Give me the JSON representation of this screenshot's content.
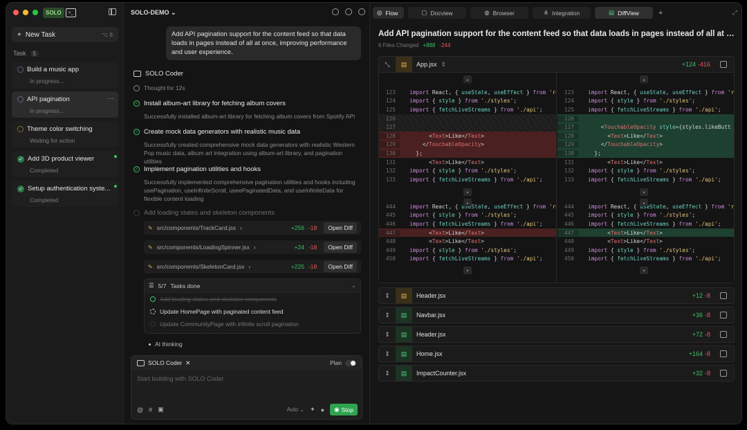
{
  "sidebar": {
    "logo": "SOLO",
    "new_task": {
      "label": "New Task",
      "shortcut": "⌥ 8"
    },
    "task_header": "Task",
    "task_count": "5",
    "tasks": [
      {
        "title": "Build a music app",
        "status": "In progress..."
      },
      {
        "title": "API pagination",
        "status": "In progress..."
      },
      {
        "title": "Theme color switching",
        "status": "Waiting for action"
      },
      {
        "title": "Add 3D product viewer",
        "status": "Completed"
      },
      {
        "title": "Setup authentication syste...",
        "status": "Completed"
      }
    ]
  },
  "chat": {
    "project": "SOLO-DEMO",
    "user_message": "Add API pagination support for the content feed so that data loads in pages instead of all at once, improving performance and user experience.",
    "agent_name": "SOLO Coder",
    "thought": "Thought for 12s",
    "steps": [
      {
        "title": "Install album-art library for fetching album covers",
        "desc": "Successfully installed album-art library for fetching album covers from Spotify API"
      },
      {
        "title": "Create mock data generators with realistic music data",
        "desc": "Successfully created comprehensive mock data generators with realistic Western Pop music data, album art integration using album-art library, and pagination utilities"
      },
      {
        "title": "Implement pagination utilities and hooks",
        "desc": "Successfully implemented comprehensive pagination utilities and hooks including usePagination, useInfiniteScroll, useePaginatedData, and useInfiniteData for flexible content loading"
      }
    ],
    "loading_step": "Add loading states and skeleton components",
    "files": [
      {
        "path": "src/components/TrackCard.jsx",
        "add": "+256",
        "del": "-18",
        "button": "Open Diff"
      },
      {
        "path": "src/components/LoadingSpinner.jsx",
        "add": "+24",
        "del": "-18",
        "button": "Open Diff"
      },
      {
        "path": "src/components/SkeletonCard.jsx",
        "add": "+225",
        "del": "-18",
        "button": "Open Diff"
      }
    ],
    "todo": {
      "progress": "5/7",
      "label": "Tasks done",
      "items": [
        {
          "text": "Add loading states and skeleton components",
          "state": "done"
        },
        {
          "text": "Update HomePage with paginated content feed",
          "state": "active"
        },
        {
          "text": "Update CommunityPage with infinite scroll pagination",
          "state": "pending"
        }
      ]
    },
    "ai_thinking": "AI thinking",
    "composer": {
      "agent": "SOLO Coder",
      "plan_label": "Plan",
      "placeholder": "Start building with SOLO Coder",
      "mode": "Auto",
      "stop": "Stop"
    }
  },
  "right": {
    "tabs": [
      "Flow",
      "Docview",
      "Browser",
      "Integration",
      "DiffView"
    ],
    "active_tab": "DiffView",
    "title": "Add API pagination support for the content feed so that data loads in pages instead of all at once, improving performance and user experience.",
    "files_changed": "6 Files Changed",
    "total_add": "+888",
    "total_del": "-244",
    "main_file": {
      "name": "App.jsx",
      "add": "+124",
      "del": "-416"
    },
    "other_files": [
      {
        "name": "Header.jsx",
        "add": "+12",
        "del": "-8",
        "color": "yellow"
      },
      {
        "name": "Navbar.jsx",
        "add": "+36",
        "del": "-8",
        "color": "green"
      },
      {
        "name": "Header.jsx",
        "add": "+72",
        "del": "-8",
        "color": "green"
      },
      {
        "name": "Home.jsx",
        "add": "+164",
        "del": "-8",
        "color": "green"
      },
      {
        "name": "ImpactCounter.jsx",
        "add": "+32",
        "del": "-8",
        "color": "green"
      }
    ],
    "left_lines": [
      {
        "n": "123",
        "code": "import React, { useState, useEffect } from 're",
        "type": "ctx"
      },
      {
        "n": "124",
        "code": "import { style } from './styles';",
        "type": "ctx"
      },
      {
        "n": "125",
        "code": "import { fetchLiveStreams } from './api';",
        "type": "ctx"
      },
      {
        "n": "126",
        "code": "",
        "type": "empty"
      },
      {
        "n": "127",
        "code": "",
        "type": "empty"
      },
      {
        "n": "128",
        "code": "      <Text>Like</Text>",
        "type": "del"
      },
      {
        "n": "129",
        "code": "    </TouchableOpacity>",
        "type": "del"
      },
      {
        "n": "130",
        "code": "  };",
        "type": "del"
      },
      {
        "n": "131",
        "code": "      <Text>Like</Text>",
        "type": "ctx"
      },
      {
        "n": "132",
        "code": "import { style } from './styles';",
        "type": "ctx"
      },
      {
        "n": "133",
        "code": "import { fetchLiveStreams } from './api';",
        "type": "ctx"
      },
      {
        "n": "444",
        "code": "import React, { useState, useEffect } from 're",
        "type": "ctx"
      },
      {
        "n": "445",
        "code": "import { style } from './styles';",
        "type": "ctx"
      },
      {
        "n": "446",
        "code": "import { fetchLiveStreams } from './api';",
        "type": "ctx"
      },
      {
        "n": "447",
        "code": "      <Text>Like</Text>",
        "type": "del"
      },
      {
        "n": "448",
        "code": "      <Text>Like</Text>",
        "type": "ctx"
      },
      {
        "n": "449",
        "code": "import { style } from './styles';",
        "type": "ctx"
      },
      {
        "n": "450",
        "code": "import { fetchLiveStreams } from './api';",
        "type": "ctx"
      }
    ],
    "right_lines": [
      {
        "n": "123",
        "code": "import React, { useState, useEffect } from 're",
        "type": "ctx"
      },
      {
        "n": "124",
        "code": "import { style } from './styles';",
        "type": "ctx"
      },
      {
        "n": "125",
        "code": "import { fetchLiveStreams } from './api';",
        "type": "ctx"
      },
      {
        "n": "126",
        "code": "",
        "type": "add"
      },
      {
        "n": "127",
        "code": "    <TouchableOpacity style={styles.likeButt",
        "type": "add"
      },
      {
        "n": "128",
        "code": "      <Text>Like</Text>",
        "type": "add"
      },
      {
        "n": "129",
        "code": "    </TouchableOpacity>",
        "type": "add"
      },
      {
        "n": "130",
        "code": "  };",
        "type": "add"
      },
      {
        "n": "131",
        "code": "      <Text>Like</Text>",
        "type": "ctx"
      },
      {
        "n": "132",
        "code": "import { style } from './styles';",
        "type": "ctx"
      },
      {
        "n": "133",
        "code": "import { fetchLiveStreams } from './api';",
        "type": "ctx"
      },
      {
        "n": "444",
        "code": "import React, { useState, useEffect } from 're",
        "type": "ctx"
      },
      {
        "n": "445",
        "code": "import { style } from './styles';",
        "type": "ctx"
      },
      {
        "n": "446",
        "code": "import { fetchLiveStreams } from './api';",
        "type": "ctx"
      },
      {
        "n": "447",
        "code": "      <Text>Like</Text>",
        "type": "add"
      },
      {
        "n": "448",
        "code": "      <Text>Like</Text>",
        "type": "ctx"
      },
      {
        "n": "449",
        "code": "import { style } from './styles';",
        "type": "ctx"
      },
      {
        "n": "450",
        "code": "import { fetchLiveStreams } from './api';",
        "type": "ctx"
      }
    ]
  }
}
